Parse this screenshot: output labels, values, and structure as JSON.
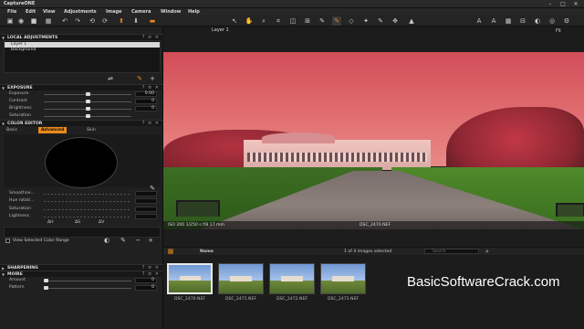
{
  "app": {
    "title": "CaptureONE"
  },
  "menu": [
    "File",
    "Edit",
    "View",
    "Adjustments",
    "Image",
    "Camera",
    "Window",
    "Help"
  ],
  "viewer_toolbar": {
    "layer_select": "Layer 1",
    "fit_label": "Fit"
  },
  "panels": {
    "local_adjustments": {
      "title": "LOCAL ADJUSTMENTS",
      "layers": [
        "Layer 1",
        "Background"
      ]
    },
    "exposure": {
      "title": "EXPOSURE",
      "sliders": [
        {
          "label": "Exposure",
          "value": "0.00",
          "position": 0.5
        },
        {
          "label": "Contrast",
          "value": "0",
          "position": 0.5
        },
        {
          "label": "Brightness",
          "value": "0",
          "position": 0.5
        },
        {
          "label": "Saturation",
          "value": "",
          "position": 0.5
        }
      ]
    },
    "color_editor": {
      "title": "COLOR EDITOR",
      "tabs": [
        "Basic",
        "Advanced",
        "Skin tone"
      ],
      "active_tab": "Advanced",
      "sliders": [
        "Smoothne...",
        "Hue rotati...",
        "Saturation",
        "Lightness"
      ],
      "hsl_labels": [
        "ΔH",
        "ΔS",
        "ΔV"
      ],
      "view_selected_label": "View Selected Color Range"
    },
    "sharpening": {
      "title": "SHARPENING"
    },
    "moire": {
      "title": "MOIRE",
      "sliders": [
        {
          "label": "Amount",
          "value": "0"
        },
        {
          "label": "Pattern",
          "value": "0"
        }
      ]
    }
  },
  "viewer": {
    "exif": "ISO 200  1/250 s  f/8  17 mm",
    "filename": "DSC_2470.NEF"
  },
  "browser": {
    "sort_label": "Name",
    "count_text": "1 of 4 images selected",
    "search_placeholder": "Search",
    "thumbnails": [
      {
        "name": "DSC_2470.NEF",
        "selected": true
      },
      {
        "name": "DSC_2471.NEF",
        "selected": false
      },
      {
        "name": "DSC_2472.NEF",
        "selected": false
      },
      {
        "name": "DSC_2473.NEF",
        "selected": false
      }
    ]
  },
  "watermark": "BasicSoftwareCrack.com",
  "colors": {
    "accent": "#e8891e",
    "panel_bg": "#202020",
    "header_bg": "#171717"
  }
}
